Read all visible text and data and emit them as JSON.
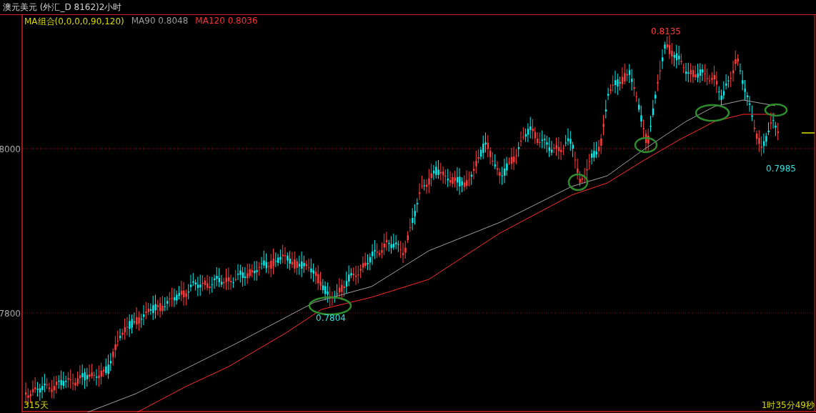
{
  "title": "澳元美元 (外汇_D 8162)2小时",
  "indicators": [
    {
      "label": "MA组合(0,0,0,0,90,120)",
      "kind": "group"
    },
    {
      "label": "MA90 0.8048",
      "kind": "ma90"
    },
    {
      "label": "MA120 0.8036",
      "kind": "ma120"
    }
  ],
  "price_axis": [
    {
      "label": "8000"
    },
    {
      "label": "7800"
    }
  ],
  "annotations": [
    {
      "text": "0.8135",
      "kind": "high"
    },
    {
      "text": "0.7804",
      "kind": "low"
    },
    {
      "text": "0.7985",
      "kind": "low"
    }
  ],
  "bar_count": "315天",
  "countdown": "1时35分49秒"
}
